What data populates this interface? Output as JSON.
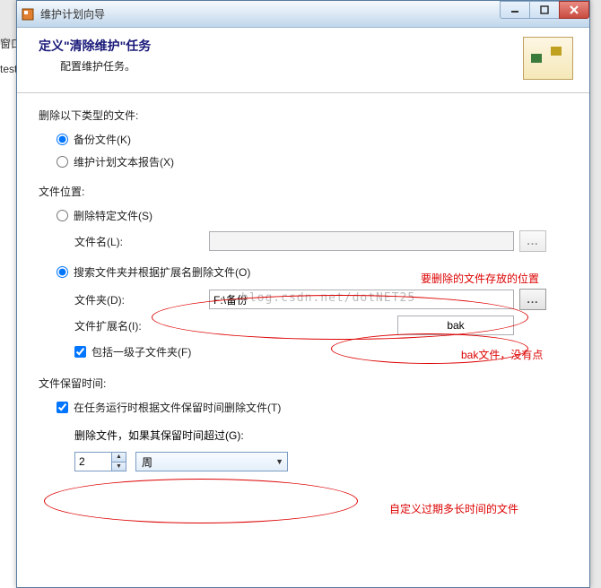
{
  "bg": {
    "fragment_window": "窗口",
    "fragment_test": "test"
  },
  "window": {
    "title": "维护计划向导"
  },
  "header": {
    "title": "定义\"清除维护\"任务",
    "subtitle": "配置维护任务。"
  },
  "section_delete_type": {
    "label": "删除以下类型的文件:",
    "opt_backup": "备份文件(K)",
    "opt_report": "维护计划文本报告(X)"
  },
  "section_location": {
    "label": "文件位置:",
    "opt_specific": "删除特定文件(S)",
    "filename_label": "文件名(L):",
    "filename_value": "",
    "opt_search": "搜索文件夹并根据扩展名删除文件(O)",
    "folder_label": "文件夹(D):",
    "folder_value": "F:\\备份",
    "ext_label": "文件扩展名(I):",
    "ext_value": "bak",
    "include_sub": "包括一级子文件夹(F)",
    "browse": "..."
  },
  "section_retain": {
    "label": "文件保留时间:",
    "opt_delete_age": "在任务运行时根据文件保留时间删除文件(T)",
    "threshold_label": "删除文件，如果其保留时间超过(G):",
    "number_value": "2",
    "unit_value": "周"
  },
  "annotations": {
    "a1": "要删除的文件存放的位置",
    "a2": "bak文件，没有点",
    "a3": "自定义过期多长时间的文件"
  },
  "watermark": "blog.csdn.net/dotNET25"
}
